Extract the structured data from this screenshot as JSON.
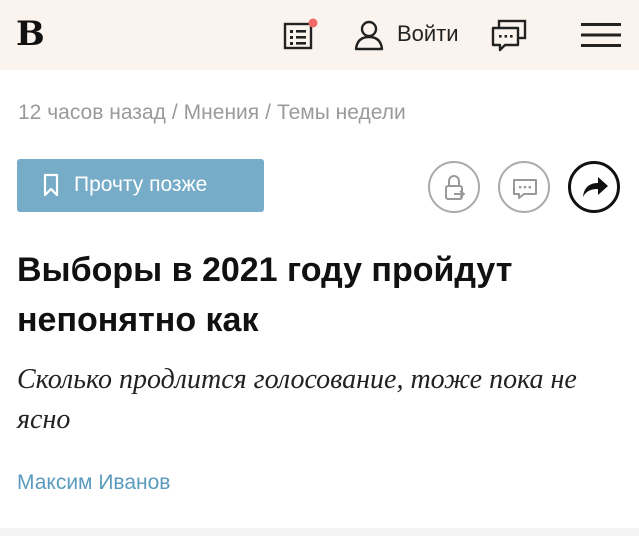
{
  "header": {
    "logo": "В",
    "login_label": "Войти",
    "notification_dot_color": "#f06a6a"
  },
  "breadcrumb": {
    "time": "12 часов назад",
    "separator": "/",
    "section": "Мнения",
    "subsection": "Темы недели"
  },
  "actions": {
    "read_later_label": "Прочту позже",
    "read_later_color": "#76acc7"
  },
  "article": {
    "headline": "Выборы в 2021 году пройдут непонятно как",
    "subtitle": "Сколько продлится голосование, тоже пока не ясно",
    "author": "Максим Иванов",
    "author_color": "#5a9bbd"
  },
  "icons": [
    "news-feed-icon",
    "user-icon",
    "chat-icon",
    "menu-icon",
    "bookmark-icon",
    "share-lock-icon",
    "comments-icon",
    "share-arrow-icon"
  ]
}
